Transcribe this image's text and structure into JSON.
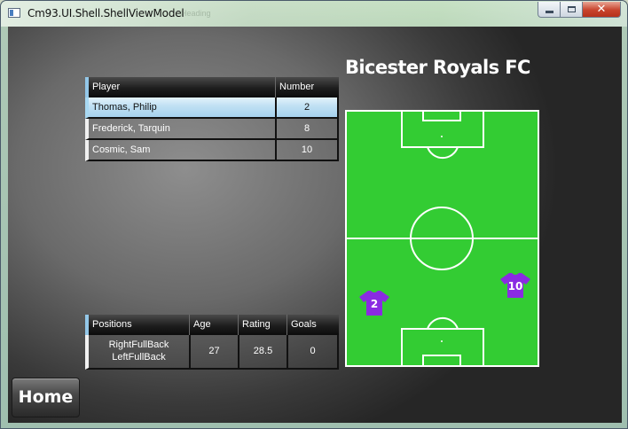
{
  "window": {
    "title": "Cm93.UI.Shell.ShellViewModel",
    "background_ghost_text": "Heading"
  },
  "players_grid": {
    "columns": [
      "Player",
      "Number"
    ],
    "rows": [
      {
        "player": "Thomas, Philip",
        "number": "2",
        "selected": true
      },
      {
        "player": "Frederick, Tarquin",
        "number": "8",
        "selected": false
      },
      {
        "player": "Cosmic, Sam",
        "number": "10",
        "selected": false
      }
    ]
  },
  "details_grid": {
    "columns": [
      "Positions",
      "Age",
      "Rating",
      "Goals"
    ],
    "row": {
      "positions": [
        "RightFullBack",
        "LeftFullBack"
      ],
      "age": "27",
      "rating": "28.5",
      "goals": "0"
    }
  },
  "team": {
    "name": "Bicester Royals FC"
  },
  "pitch": {
    "shirts": [
      {
        "number": "2",
        "color": "#8a2be2"
      },
      {
        "number": "10",
        "color": "#8a2be2"
      }
    ],
    "grass_color": "#33cc33",
    "line_color": "#ffffff"
  },
  "buttons": {
    "home": "Home"
  },
  "colors": {
    "header_accent": "#93c7e8",
    "selection": "#bfe0f3"
  }
}
